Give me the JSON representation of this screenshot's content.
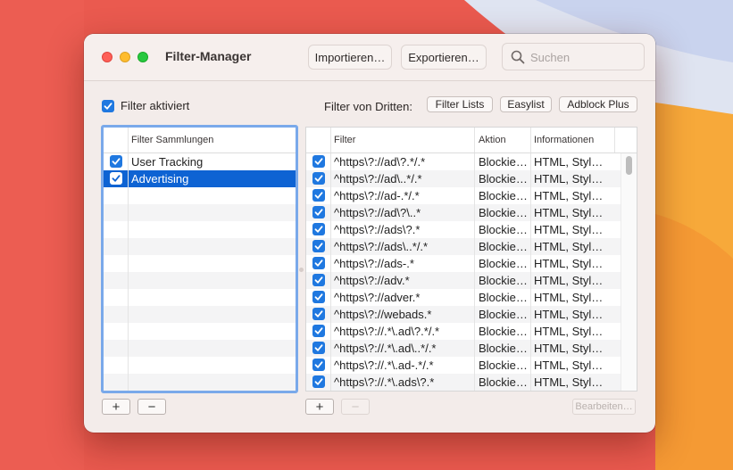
{
  "window": {
    "title": "Filter-Manager"
  },
  "toolbar": {
    "import_label": "Importieren…",
    "export_label": "Exportieren…",
    "search_placeholder": "Suchen"
  },
  "filter_enabled": {
    "label": "Filter aktiviert",
    "checked": true
  },
  "third_party": {
    "label": "Filter von Dritten:",
    "buttons": [
      "Filter Lists",
      "Easylist",
      "Adblock Plus"
    ]
  },
  "collections": {
    "header": "Filter Sammlungen",
    "items": [
      {
        "label": "User Tracking",
        "checked": true,
        "selected": false
      },
      {
        "label": "Advertising",
        "checked": true,
        "selected": true
      }
    ]
  },
  "filters": {
    "headers": {
      "filter": "Filter",
      "action": "Aktion",
      "info": "Informationen"
    },
    "rows": [
      {
        "filter": "^https\\?://ad\\?.*/.*",
        "action": "Blockie…",
        "info": "HTML, Styl…",
        "checked": true
      },
      {
        "filter": "^https\\?://ad\\..*/.*",
        "action": "Blockie…",
        "info": "HTML, Styl…",
        "checked": true
      },
      {
        "filter": "^https\\?://ad-.*/.*",
        "action": "Blockie…",
        "info": "HTML, Styl…",
        "checked": true
      },
      {
        "filter": "^https\\?://ad\\?\\..*",
        "action": "Blockie…",
        "info": "HTML, Styl…",
        "checked": true
      },
      {
        "filter": "^https\\?://ads\\?.*",
        "action": "Blockie…",
        "info": "HTML, Styl…",
        "checked": true
      },
      {
        "filter": "^https\\?://ads\\..*/.*",
        "action": "Blockie…",
        "info": "HTML, Styl…",
        "checked": true
      },
      {
        "filter": "^https\\?://ads-.*",
        "action": "Blockie…",
        "info": "HTML, Styl…",
        "checked": true
      },
      {
        "filter": "^https\\?://adv.*",
        "action": "Blockie…",
        "info": "HTML, Styl…",
        "checked": true
      },
      {
        "filter": "^https\\?://adver.*",
        "action": "Blockie…",
        "info": "HTML, Styl…",
        "checked": true
      },
      {
        "filter": "^https\\?://webads.*",
        "action": "Blockie…",
        "info": "HTML, Styl…",
        "checked": true
      },
      {
        "filter": "^https\\?://.*\\.ad\\?.*/.*",
        "action": "Blockie…",
        "info": "HTML, Styl…",
        "checked": true
      },
      {
        "filter": "^https\\?://.*\\.ad\\..*/.*",
        "action": "Blockie…",
        "info": "HTML, Styl…",
        "checked": true
      },
      {
        "filter": "^https\\?://.*\\.ad-.*/.*",
        "action": "Blockie…",
        "info": "HTML, Styl…",
        "checked": true
      },
      {
        "filter": "^https\\?://.*\\.ads\\?.*",
        "action": "Blockie…",
        "info": "HTML, Styl…",
        "checked": true
      }
    ]
  },
  "footer": {
    "add_label": "+",
    "remove_label": "−",
    "edit_label": "Bearbeiten…"
  },
  "colors": {
    "accent": "#1f78e0",
    "selection": "#0e63d3"
  }
}
